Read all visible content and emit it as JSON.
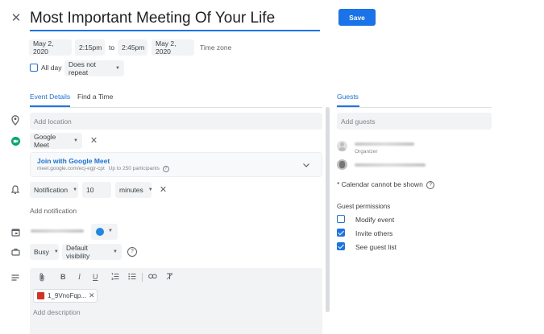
{
  "header": {
    "title": "Most Important Meeting Of Your Life",
    "save_label": "Save"
  },
  "datetime": {
    "start_date": "May 2, 2020",
    "start_time": "2:15pm",
    "to_label": "to",
    "end_time": "2:45pm",
    "end_date": "May 2, 2020",
    "timezone_label": "Time zone",
    "all_day_label": "All day",
    "repeat_label": "Does not repeat"
  },
  "tabs": {
    "event_details": "Event Details",
    "find_time": "Find a Time",
    "guests": "Guests"
  },
  "details": {
    "location_placeholder": "Add location",
    "conference_label": "Google Meet",
    "join_label": "Join with Google Meet",
    "meet_link": "meet.google.com/ecj-egjr-cpt",
    "participants_label": "Up to 250 participants",
    "notification_type": "Notification",
    "notification_value": "10",
    "notification_unit": "minutes",
    "add_notification": "Add notification",
    "status_label": "Busy",
    "visibility_label": "Default visibility",
    "attachment_name": "1_9VnoFqp...",
    "description_placeholder": "Add description"
  },
  "guests": {
    "add_guests_placeholder": "Add guests",
    "organizer_label": "Organizer",
    "calendar_warning": "* Calendar cannot be shown",
    "permissions_title": "Guest permissions",
    "permissions": [
      {
        "label": "Modify event",
        "checked": false
      },
      {
        "label": "Invite others",
        "checked": true
      },
      {
        "label": "See guest list",
        "checked": true
      }
    ]
  },
  "colors": {
    "accent": "#1a73e8",
    "event_color": "#1e88e5",
    "meet_green": "#00a86b",
    "attachment_red": "#d93025"
  },
  "icons": [
    "close-icon",
    "location-icon",
    "meet-icon",
    "bell-icon",
    "calendar-icon",
    "briefcase-icon",
    "description-icon",
    "help-icon",
    "attach-icon",
    "bold-icon",
    "italic-icon",
    "underline-icon",
    "numbered-list-icon",
    "bulleted-list-icon",
    "link-icon",
    "clear-format-icon",
    "chevron-down-icon"
  ]
}
